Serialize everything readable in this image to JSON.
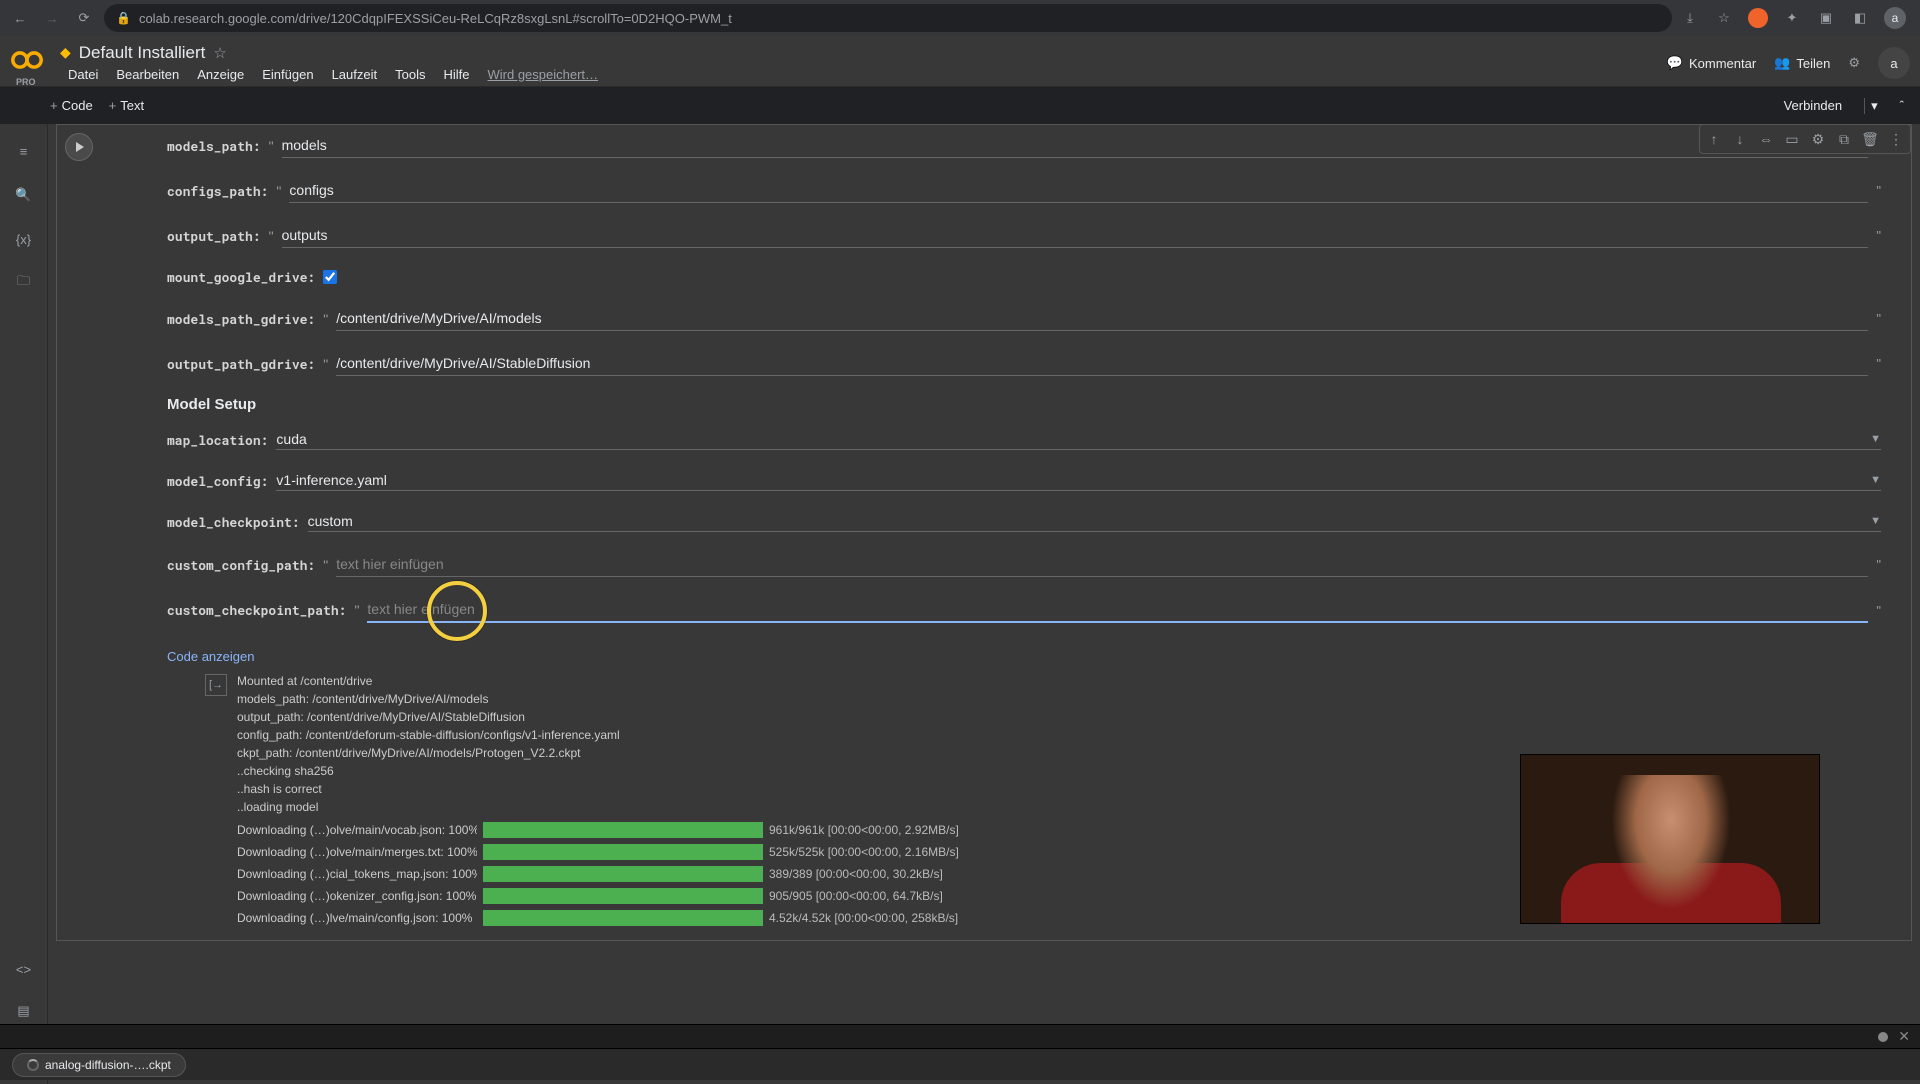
{
  "browser": {
    "url": "colab.research.google.com/drive/120CdqpIFEXSSiCeu-ReLCqRz8sxgLsnL#scrollTo=0D2HQO-PWM_t",
    "avatar": "a"
  },
  "header": {
    "title": "Default Installiert",
    "pro": "PRO",
    "menus": [
      "Datei",
      "Bearbeiten",
      "Anzeige",
      "Einfügen",
      "Laufzeit",
      "Tools",
      "Hilfe"
    ],
    "saving": "Wird gespeichert…",
    "comment": "Kommentar",
    "share": "Teilen",
    "avatar": "a"
  },
  "toolbar": {
    "code": "Code",
    "text": "Text",
    "connect": "Verbinden"
  },
  "form": {
    "models_path": {
      "label": "models_path:",
      "value": "models"
    },
    "configs_path": {
      "label": "configs_path:",
      "value": "configs"
    },
    "output_path": {
      "label": "output_path:",
      "value": "outputs"
    },
    "mount_google_drive": {
      "label": "mount_google_drive:"
    },
    "models_path_gdrive": {
      "label": "models_path_gdrive:",
      "value": "/content/drive/MyDrive/AI/models"
    },
    "output_path_gdrive": {
      "label": "output_path_gdrive:",
      "value": "/content/drive/MyDrive/AI/StableDiffusion"
    },
    "section_model_setup": "Model Setup",
    "map_location": {
      "label": "map_location:",
      "value": "cuda"
    },
    "model_config": {
      "label": "model_config:",
      "value": "v1-inference.yaml"
    },
    "model_checkpoint": {
      "label": "model_checkpoint:",
      "value": "custom"
    },
    "custom_config_path": {
      "label": "custom_config_path:",
      "placeholder": "text hier einfügen"
    },
    "custom_checkpoint_path": {
      "label": "custom_checkpoint_path:",
      "placeholder": "text hier einfügen"
    },
    "show_code": "Code anzeigen"
  },
  "output": {
    "lines": [
      "Mounted at /content/drive",
      "models_path: /content/drive/MyDrive/AI/models",
      "output_path: /content/drive/MyDrive/AI/StableDiffusion",
      "config_path: /content/deforum-stable-diffusion/configs/v1-inference.yaml",
      "ckpt_path: /content/drive/MyDrive/AI/models/Protogen_V2.2.ckpt",
      "..checking sha256",
      "..hash is correct",
      "..loading model"
    ],
    "progress": [
      {
        "label": "Downloading (…)olve/main/vocab.json: 100%",
        "pct": 100,
        "stats": "961k/961k [00:00<00:00, 2.92MB/s]"
      },
      {
        "label": "Downloading (…)olve/main/merges.txt: 100%",
        "pct": 100,
        "stats": "525k/525k [00:00<00:00, 2.16MB/s]"
      },
      {
        "label": "Downloading (…)cial_tokens_map.json: 100%",
        "pct": 100,
        "stats": "389/389 [00:00<00:00, 30.2kB/s]"
      },
      {
        "label": "Downloading (…)okenizer_config.json: 100%",
        "pct": 100,
        "stats": "905/905 [00:00<00:00, 64.7kB/s]"
      },
      {
        "label": "Downloading (…)lve/main/config.json: 100%",
        "pct": 100,
        "stats": "4.52k/4.52k [00:00<00:00, 258kB/s]"
      }
    ]
  },
  "downloads": {
    "item": "analog-diffusion-….ckpt"
  }
}
